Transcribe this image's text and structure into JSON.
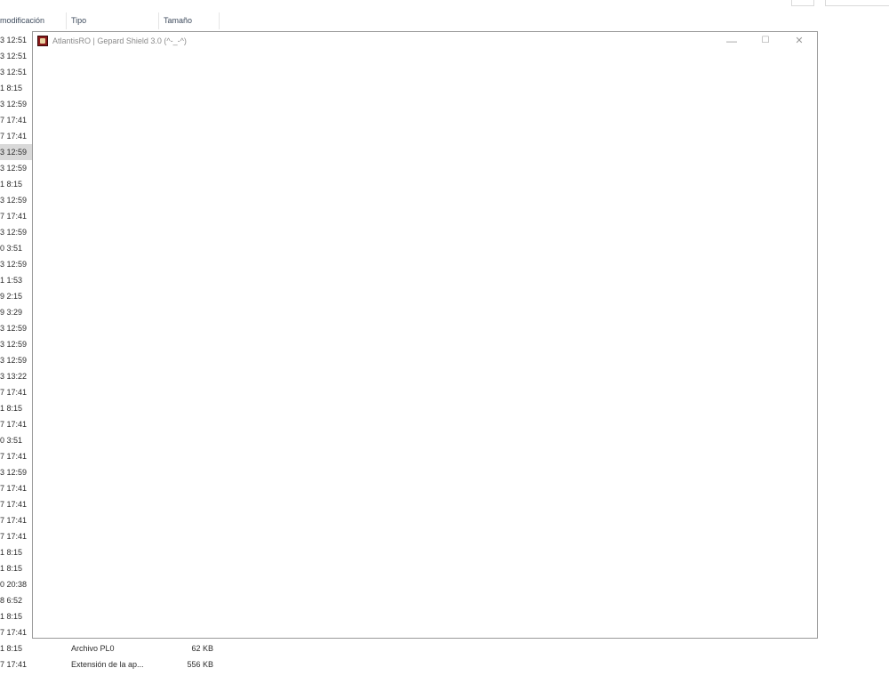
{
  "explorer": {
    "columns": {
      "date": "modificación",
      "type": "Tipo",
      "size": "Tamaño"
    },
    "rows": [
      {
        "date": "3 12:51",
        "type": "",
        "size": ""
      },
      {
        "date": "3 12:51",
        "type": "",
        "size": ""
      },
      {
        "date": "3 12:51",
        "type": "",
        "size": ""
      },
      {
        "date": "1 8:15",
        "type": "",
        "size": ""
      },
      {
        "date": "3 12:59",
        "type": "",
        "size": ""
      },
      {
        "date": "7 17:41",
        "type": "",
        "size": ""
      },
      {
        "date": "7 17:41",
        "type": "",
        "size": ""
      },
      {
        "date": "3 12:59",
        "type": "",
        "size": "",
        "selected": true
      },
      {
        "date": "3 12:59",
        "type": "",
        "size": ""
      },
      {
        "date": "1 8:15",
        "type": "",
        "size": ""
      },
      {
        "date": "3 12:59",
        "type": "",
        "size": ""
      },
      {
        "date": "7 17:41",
        "type": "",
        "size": ""
      },
      {
        "date": "3 12:59",
        "type": "",
        "size": ""
      },
      {
        "date": "0 3:51",
        "type": "",
        "size": ""
      },
      {
        "date": "3 12:59",
        "type": "",
        "size": ""
      },
      {
        "date": "1 1:53",
        "type": "",
        "size": ""
      },
      {
        "date": "9 2:15",
        "type": "",
        "size": ""
      },
      {
        "date": "9 3:29",
        "type": "",
        "size": ""
      },
      {
        "date": "3 12:59",
        "type": "",
        "size": ""
      },
      {
        "date": "3 12:59",
        "type": "",
        "size": ""
      },
      {
        "date": "3 12:59",
        "type": "",
        "size": ""
      },
      {
        "date": "3 13:22",
        "type": "",
        "size": ""
      },
      {
        "date": "7 17:41",
        "type": "",
        "size": ""
      },
      {
        "date": "1 8:15",
        "type": "",
        "size": ""
      },
      {
        "date": "7 17:41",
        "type": "",
        "size": ""
      },
      {
        "date": "0 3:51",
        "type": "",
        "size": ""
      },
      {
        "date": "7 17:41",
        "type": "",
        "size": ""
      },
      {
        "date": "3 12:59",
        "type": "",
        "size": ""
      },
      {
        "date": "7 17:41",
        "type": "",
        "size": ""
      },
      {
        "date": "7 17:41",
        "type": "",
        "size": ""
      },
      {
        "date": "7 17:41",
        "type": "",
        "size": ""
      },
      {
        "date": "7 17:41",
        "type": "",
        "size": ""
      },
      {
        "date": "1 8:15",
        "type": "",
        "size": ""
      },
      {
        "date": "1 8:15",
        "type": "",
        "size": ""
      },
      {
        "date": "0 20:38",
        "type": "",
        "size": ""
      },
      {
        "date": "8 6:52",
        "type": "",
        "size": ""
      },
      {
        "date": "1 8:15",
        "type": "",
        "size": ""
      },
      {
        "date": "7 17:41",
        "type": "",
        "size": ""
      },
      {
        "date": "1 8:15",
        "type": "Archivo PL0",
        "size": "62 KB"
      },
      {
        "date": "7 17:41",
        "type": "Extensión de la ap...",
        "size": "556 KB"
      }
    ]
  },
  "app_window": {
    "title": "AtlantisRO | Gepard Shield 3.0 (^-_-^)",
    "icon": "atlantisro-app-icon",
    "minimize_glyph": "—",
    "maximize_glyph": "☐",
    "close_glyph": "✕"
  },
  "colors": {
    "selected_row": "#d9d9d9",
    "header_text": "#3d4a5c",
    "title_text": "#8a8a8a",
    "window_border": "#9a9a9a"
  }
}
